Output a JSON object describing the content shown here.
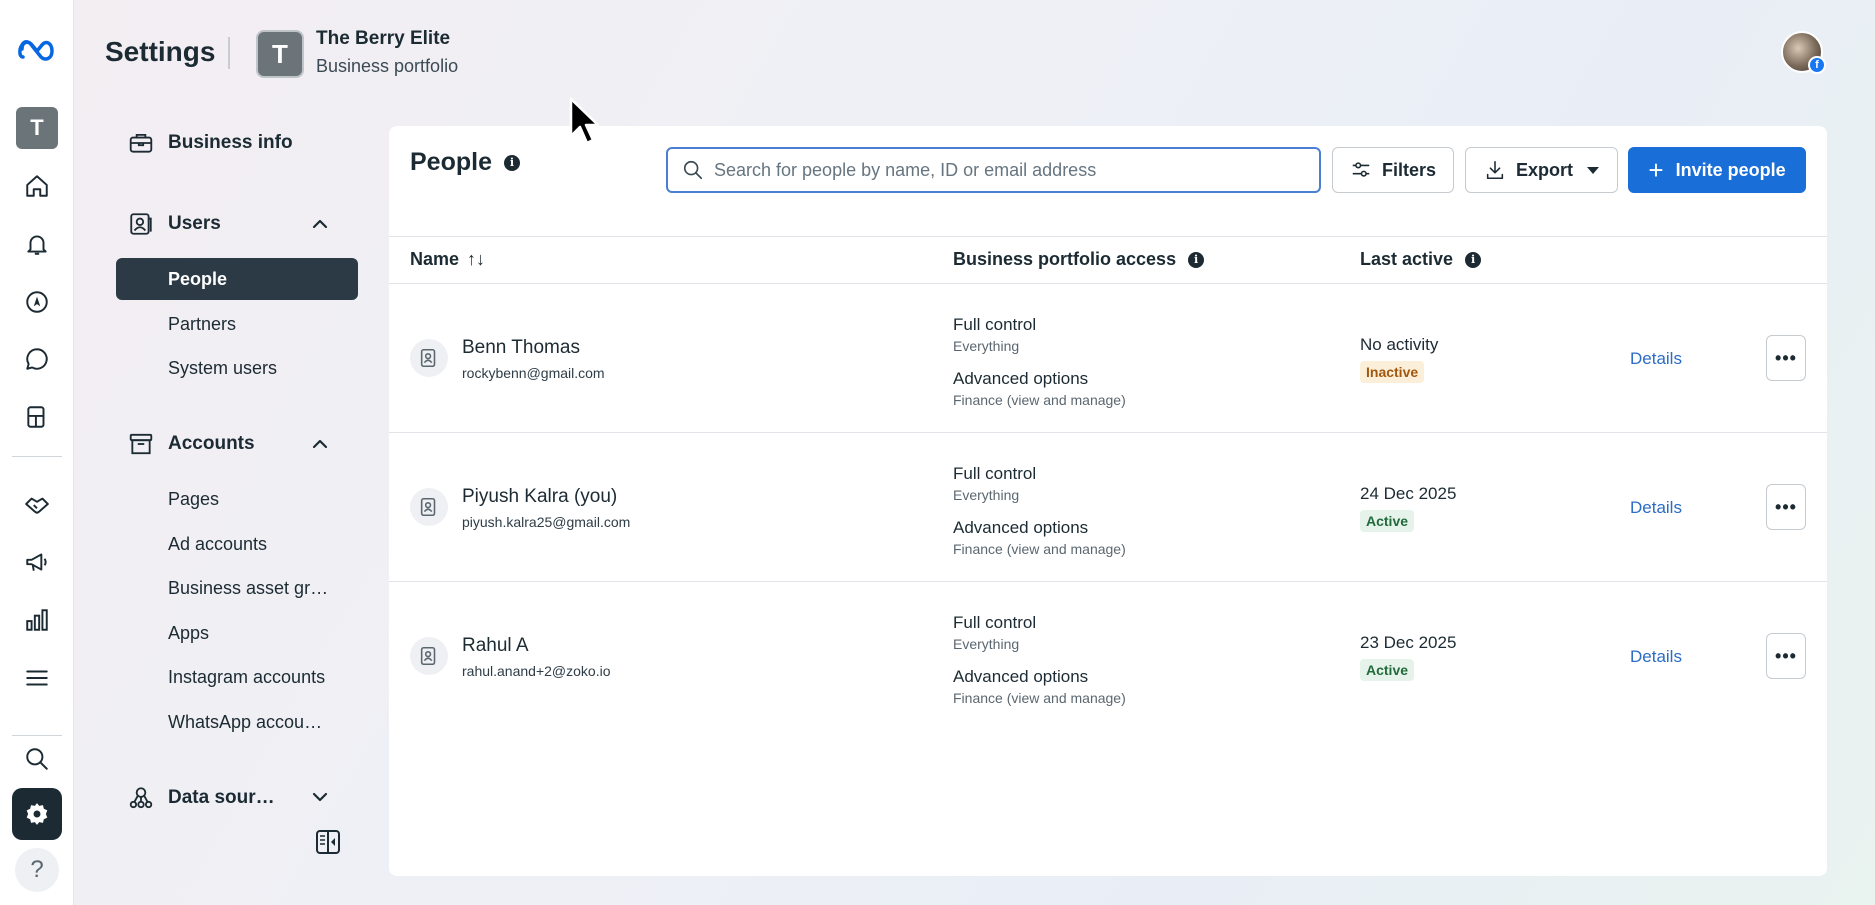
{
  "header": {
    "title": "Settings",
    "portfolio_initial": "T",
    "portfolio_name": "The Berry Elite",
    "portfolio_sub": "Business portfolio"
  },
  "rail": {
    "avatar_initial": "T",
    "icons": [
      "meta-logo-icon",
      "home-icon",
      "bell-icon",
      "navigation-icon",
      "chat-icon",
      "pages-icon",
      "handshake-icon",
      "megaphone-icon",
      "bar-chart-icon",
      "menu-icon",
      "search-icon",
      "gear-icon",
      "help-icon"
    ],
    "help_label": "?"
  },
  "sidebar": {
    "business_info": "Business info",
    "users": {
      "label": "Users",
      "items": [
        "People",
        "Partners",
        "System users"
      ]
    },
    "accounts": {
      "label": "Accounts",
      "items": [
        "Pages",
        "Ad accounts",
        "Business asset gr…",
        "Apps",
        "Instagram accounts",
        "WhatsApp accou…"
      ]
    },
    "data_sources": "Data sour…"
  },
  "panel": {
    "title": "People",
    "search_placeholder": "Search for people by name, ID or email address",
    "filters_label": "Filters",
    "export_label": "Export",
    "invite_label": "Invite people",
    "columns": {
      "name": "Name",
      "sort_glyph": "↑↓",
      "access": "Business portfolio access",
      "last_active": "Last active"
    },
    "rows": [
      {
        "name": "Benn Thomas",
        "email": "rockybenn@gmail.com",
        "access1_title": "Full control",
        "access1_sub": "Everything",
        "access2_title": "Advanced options",
        "access2_sub": "Finance (view and manage)",
        "last_active": "No activity",
        "status": "Inactive",
        "details": "Details",
        "more": "•••"
      },
      {
        "name": "Piyush Kalra (you)",
        "email": "piyush.kalra25@gmail.com",
        "access1_title": "Full control",
        "access1_sub": "Everything",
        "access2_title": "Advanced options",
        "access2_sub": "Finance (view and manage)",
        "last_active": "24 Dec 2025",
        "status": "Active",
        "details": "Details",
        "more": "•••"
      },
      {
        "name": "Rahul A",
        "email": "rahul.anand+2@zoko.io",
        "access1_title": "Full control",
        "access1_sub": "Everything",
        "access2_title": "Advanced options",
        "access2_sub": "Finance (view and manage)",
        "last_active": "23 Dec 2025",
        "status": "Active",
        "details": "Details",
        "more": "•••"
      }
    ]
  },
  "colors": {
    "primary": "#1a6ed8",
    "selected_nav": "#2b3a44",
    "link": "#2b6cc4",
    "inactive_badge": "#fcefd9",
    "active_badge": "#e6f3ea"
  }
}
